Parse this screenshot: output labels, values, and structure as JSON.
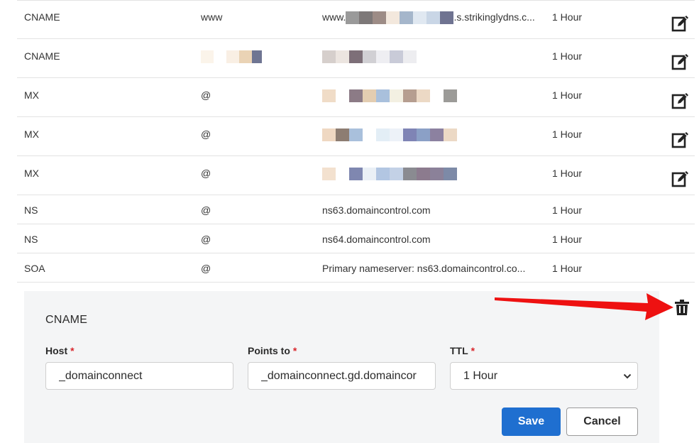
{
  "records": [
    {
      "type": "CNAME",
      "name": "www",
      "value": "www.",
      "value_suffix": ".s.strikinglydns.c...",
      "ttl": "1 Hour",
      "editable": true
    },
    {
      "type": "CNAME",
      "name": "",
      "value": "",
      "value_suffix": "",
      "ttl": "1 Hour",
      "editable": true
    },
    {
      "type": "MX",
      "name": "@",
      "value": "",
      "value_suffix": "",
      "ttl": "1 Hour",
      "editable": true
    },
    {
      "type": "MX",
      "name": "@",
      "value": "",
      "value_suffix": "",
      "ttl": "1 Hour",
      "editable": true
    },
    {
      "type": "MX",
      "name": "@",
      "value": "",
      "value_suffix": "",
      "ttl": "1 Hour",
      "editable": true
    },
    {
      "type": "NS",
      "name": "@",
      "value": "ns63.domaincontrol.com",
      "ttl": "1 Hour",
      "editable": false
    },
    {
      "type": "NS",
      "name": "@",
      "value": "ns64.domaincontrol.com",
      "ttl": "1 Hour",
      "editable": false
    },
    {
      "type": "SOA",
      "name": "@",
      "value": "Primary nameserver: ns63.domaincontrol.co...",
      "ttl": "1 Hour",
      "editable": false
    }
  ],
  "icons": {
    "edit": "edit-icon",
    "delete": "trash-icon",
    "annotation": "red-arrow"
  },
  "edit_form": {
    "title": "CNAME",
    "host_label": "Host",
    "host_value": "_domainconnect",
    "points_to_label": "Points to",
    "points_to_value": "_domainconnect.gd.domaincor",
    "ttl_label": "TTL",
    "ttl_value": "1 Hour",
    "required_mark": "*",
    "save_label": "Save",
    "cancel_label": "Cancel"
  },
  "colors": {
    "primary": "#1f6fd0",
    "required": "#d9262c",
    "annotation_arrow": "#ee1111"
  }
}
